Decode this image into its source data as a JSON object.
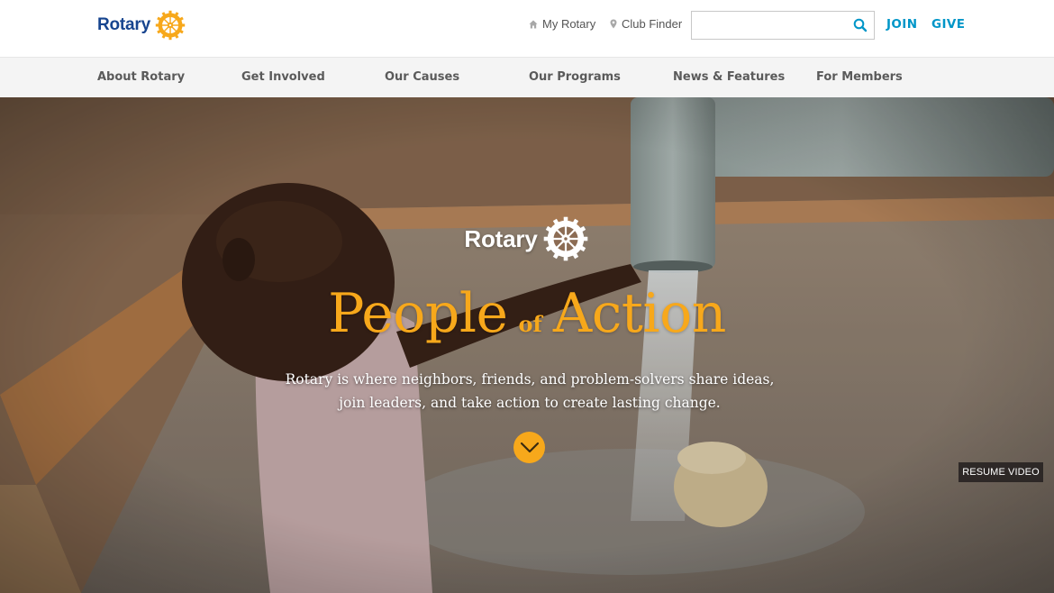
{
  "header": {
    "logo_text": "Rotary",
    "utility_links": {
      "my_rotary": "My Rotary",
      "club_finder": "Club Finder"
    },
    "search": {
      "placeholder": "",
      "value": ""
    },
    "join_label": "JOIN",
    "give_label": "GIVE"
  },
  "nav": {
    "items": [
      {
        "label": "About Rotary"
      },
      {
        "label": "Get Involved"
      },
      {
        "label": "Our Causes"
      },
      {
        "label": "Our Programs"
      },
      {
        "label": "News & Features"
      },
      {
        "label": "For Members"
      }
    ]
  },
  "hero": {
    "brand_text": "Rotary",
    "title_part1": "People",
    "title_connector": "of",
    "title_part2": "Action",
    "description": "Rotary is where neighbors, friends, and problem-solvers share ideas, join leaders, and take action to create lasting change.",
    "resume_video_label": "RESUME VIDEO"
  },
  "icons": {
    "logo": "rotary-wheel-icon",
    "my_rotary": "home-icon",
    "club_finder": "map-pin-icon",
    "search": "search-icon",
    "scroll": "chevron-down-icon"
  },
  "colors": {
    "brand_blue": "#17458f",
    "gold": "#f7a81b",
    "cta_blue": "#0096c8",
    "nav_bg": "#f4f4f4",
    "nav_text": "#5a5a5a"
  }
}
